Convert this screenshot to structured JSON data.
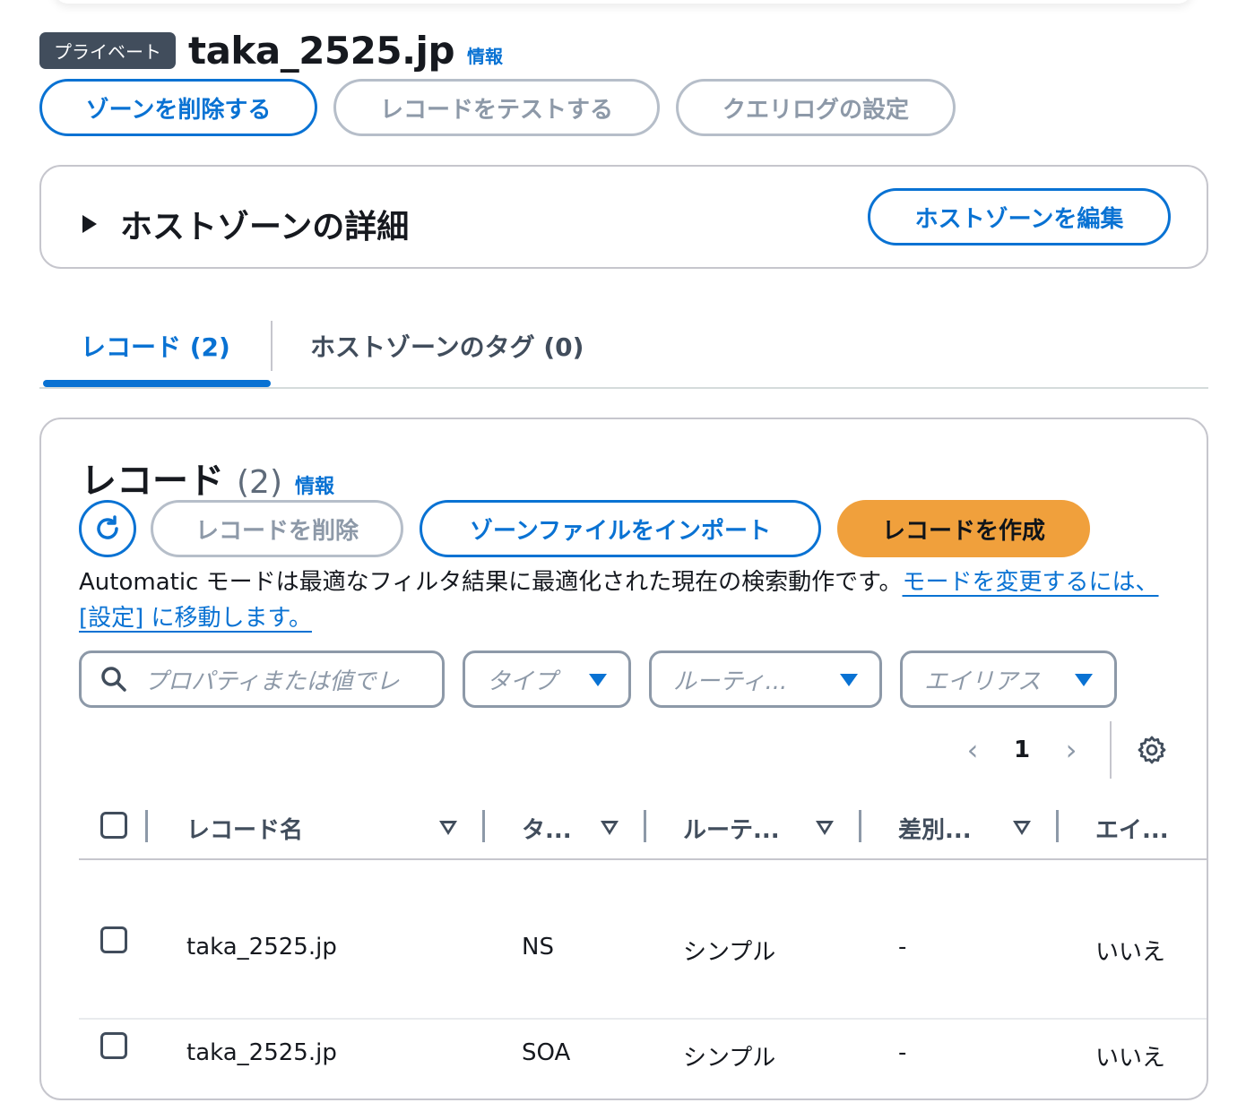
{
  "header": {
    "badge": "プライベート",
    "title": "taka_2525.jp",
    "info": "情報"
  },
  "actions": {
    "delete_zone": "ゾーンを削除する",
    "test_record": "レコードをテストする",
    "query_log": "クエリログの設定"
  },
  "details": {
    "title": "ホストゾーンの詳細",
    "edit_button": "ホストゾーンを編集"
  },
  "tabs": {
    "records": "レコード (2)",
    "tags": "ホストゾーンのタグ (0)"
  },
  "records": {
    "title": "レコード",
    "count": "(2)",
    "info": "情報",
    "delete_button": "レコードを削除",
    "import_button": "ゾーンファイルをインポート",
    "create_button": "レコードを作成",
    "description": "Automatic モードは最適なフィルタ結果に最適化された現在の検索動作です。",
    "description_link": "モードを変更するには、[設定] に移動します。",
    "search_placeholder": "プロパティまたは値でレ",
    "filters": {
      "type": "タイプ",
      "routing": "ルーティ...",
      "alias": "エイリアス"
    },
    "pagination": {
      "prev": "‹",
      "page": "1",
      "next": "›"
    },
    "columns": {
      "name": "レコード名",
      "type": "タ...",
      "routing": "ルーテ...",
      "differentiator": "差別...",
      "alias": "エイ..."
    },
    "rows": [
      {
        "name": "taka_2525.jp",
        "type": "NS",
        "routing": "シンプル",
        "differentiator": "-",
        "alias": "いいえ"
      },
      {
        "name": "taka_2525.jp",
        "type": "SOA",
        "routing": "シンプル",
        "differentiator": "-",
        "alias": "いいえ"
      }
    ]
  },
  "colors": {
    "accent": "#0972d3",
    "primary_action": "#f0a03c",
    "badge_bg": "#414d5c"
  },
  "icons": {
    "refresh": "refresh-icon",
    "search": "search-icon",
    "settings": "gear-icon",
    "expand": "caret-right-icon",
    "sort": "sort-down-icon",
    "dropdown": "caret-down-icon"
  }
}
